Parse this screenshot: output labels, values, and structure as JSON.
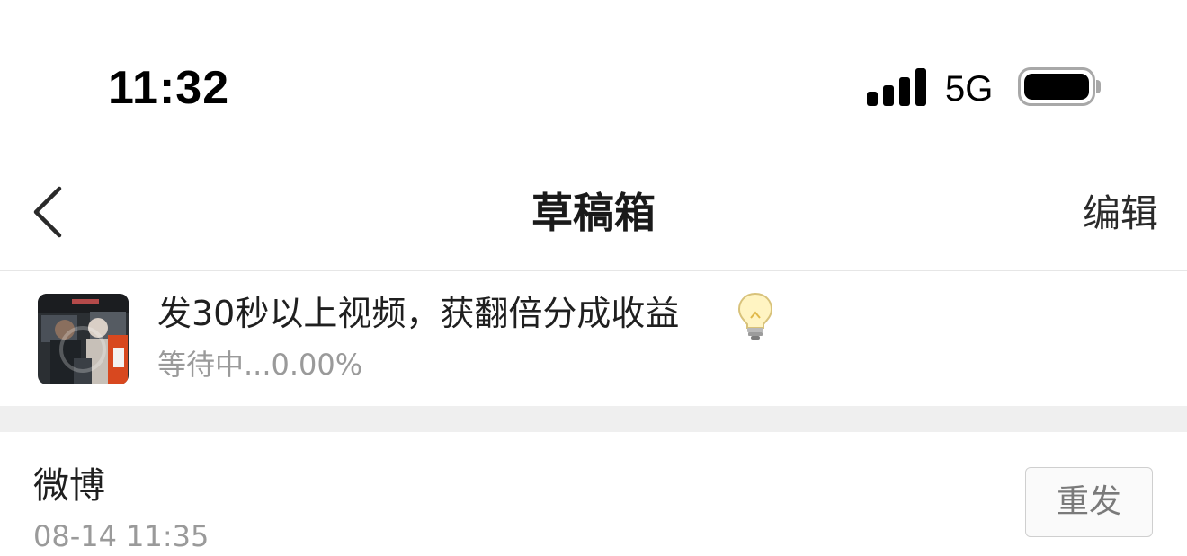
{
  "status_bar": {
    "time": "11:32",
    "network": "5G",
    "signal_bars": 4,
    "battery_level": 1.0
  },
  "nav": {
    "back_icon": "chevron-left-icon",
    "title": "草稿箱",
    "edit_label": "编辑"
  },
  "upload": {
    "title": "发30秒以上视频，获翻倍分成收益",
    "emoji_icon": "lightbulb-icon",
    "status": "等待中...0.00%",
    "progress": 0.0
  },
  "drafts": [
    {
      "source": "微博",
      "time": "08-14 11:35",
      "action_label": "重发"
    }
  ],
  "colors": {
    "text_primary": "#1a1a1a",
    "text_secondary": "#9a9a9a",
    "separator": "#efefef",
    "button_border": "#cfcfcf"
  }
}
